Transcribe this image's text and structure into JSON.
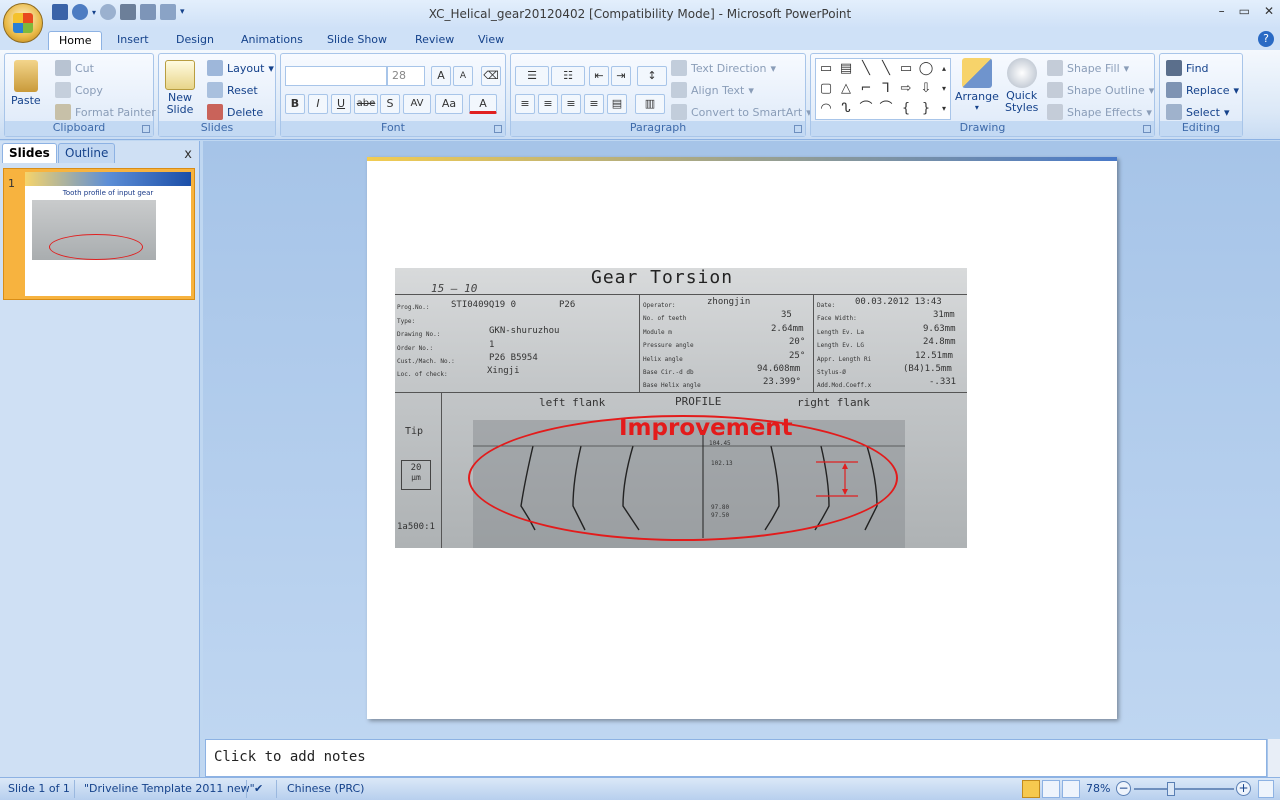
{
  "window": {
    "title": "XC_Helical_gear20120402 [Compatibility Mode] - Microsoft PowerPoint",
    "controls": [
      "–",
      "▭",
      "✕"
    ]
  },
  "tabs": [
    "Home",
    "Insert",
    "Design",
    "Animations",
    "Slide Show",
    "Review",
    "View"
  ],
  "ribbon": {
    "clipboard": {
      "paste": "Paste",
      "cut": "Cut",
      "copy": "Copy",
      "format_painter": "Format Painter",
      "label": "Clipboard"
    },
    "slides": {
      "new_slide_1": "New",
      "new_slide_2": "Slide",
      "layout": "Layout",
      "reset": "Reset",
      "delete": "Delete",
      "label": "Slides"
    },
    "font": {
      "font_name": "",
      "font_size": "28",
      "label": "Font",
      "format_buttons": [
        "B",
        "I",
        "U",
        "abe",
        "S",
        "AV",
        "Aa",
        "A"
      ]
    },
    "paragraph": {
      "text_direction": "Text Direction",
      "align_text": "Align Text",
      "convert_smartart": "Convert to SmartArt",
      "label": "Paragraph"
    },
    "drawing": {
      "arrange": "Arrange",
      "quick_styles_1": "Quick",
      "quick_styles_2": "Styles",
      "shape_fill": "Shape Fill",
      "shape_outline": "Shape Outline",
      "shape_effects": "Shape Effects",
      "label": "Drawing",
      "shapes": [
        "▭",
        "▤",
        "╲",
        "╲",
        "▭",
        "◯",
        "▢",
        "△",
        "⌐",
        "⅂",
        "⇨",
        "⇩",
        "◠",
        "ᔐ",
        "⌒",
        "⌒",
        "{",
        "}"
      ]
    },
    "editing": {
      "find": "Find",
      "replace": "Replace",
      "select": "Select",
      "label": "Editing"
    }
  },
  "left_pane": {
    "tab_slides": "Slides",
    "tab_outline": "Outline",
    "close": "x",
    "thumbnail": {
      "number": "1",
      "title": "Tooth profile of input gear"
    }
  },
  "slide": {
    "photo": {
      "title": "Gear Torsion",
      "handwritten": "15 — 10",
      "left_fields": [
        {
          "label": "Prog.No.:",
          "value": "STI0409Q19 0",
          "extra": "P26"
        },
        {
          "label": "Type:",
          "value": ""
        },
        {
          "label": "Drawing No.:",
          "value": "GKN-shuruzhou"
        },
        {
          "label": "Order No.:",
          "value": "1"
        },
        {
          "label": "Cust./Mach. No.:",
          "value": "P26 B5954"
        },
        {
          "label": "Loc. of check:",
          "value": "Xingji"
        }
      ],
      "mid_fields": [
        {
          "label": "Operator:",
          "value": "zhongjin"
        },
        {
          "label": "No. of teeth",
          "value": "35"
        },
        {
          "label": "Module m",
          "value": "2.64mm"
        },
        {
          "label": "Pressure angle",
          "value": "20°"
        },
        {
          "label": "Helix angle",
          "value": "25°"
        },
        {
          "label": "Base Cir.-d db",
          "value": "94.608mm"
        },
        {
          "label": "Base Helix angle",
          "value": "23.399°"
        }
      ],
      "right_fields": [
        {
          "label": "Date:",
          "value": "00.03.2012 13:43"
        },
        {
          "label": "Face Width:",
          "value": "31mm"
        },
        {
          "label": "Length Ev. La",
          "value": "9.63mm"
        },
        {
          "label": "Length Ev. LG",
          "value": "24.8mm"
        },
        {
          "label": "Appr. Length Ri",
          "value": "12.51mm"
        },
        {
          "label": "Stylus-Ø",
          "value": "(B4)1.5mm"
        },
        {
          "label": "Add.Mod.Coeff.x",
          "value": "-.331"
        }
      ],
      "left_flank": "left flank",
      "profile": "PROFILE",
      "right_flank": "right flank",
      "tip": "Tip",
      "scale_box": "20\nµm",
      "scale_20": "20",
      "scale_um": "µm",
      "ratio": "1a500:1",
      "axis_labels": [
        "104.45",
        "102.13",
        "97.80",
        "97.50"
      ]
    },
    "annotation": "Improvement"
  },
  "notes": {
    "placeholder": "Click to add notes"
  },
  "status": {
    "slide_info": "Slide 1 of 1",
    "template": "\"Driveline Template 2011 new\"",
    "language": "Chinese (PRC)",
    "zoom": "78%"
  }
}
